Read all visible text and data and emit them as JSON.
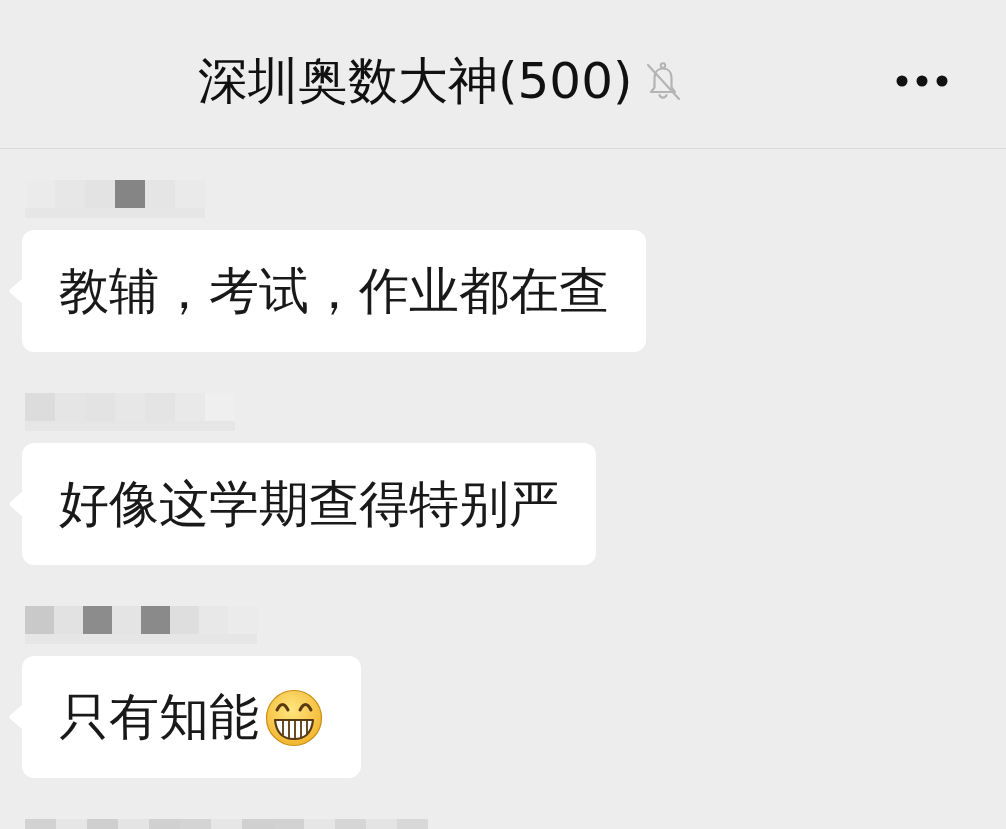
{
  "header": {
    "title": "深圳奥数大神(500)",
    "muted": true
  },
  "messages": [
    {
      "sender_blurred": true,
      "text": "教辅，考试，作业都在查"
    },
    {
      "sender_blurred": true,
      "text": "好像这学期查得特别严"
    },
    {
      "sender_blurred": true,
      "text": "只有知能",
      "emoji": {
        "kind": "grin"
      }
    },
    {
      "sender_blurred": true
    }
  ]
}
